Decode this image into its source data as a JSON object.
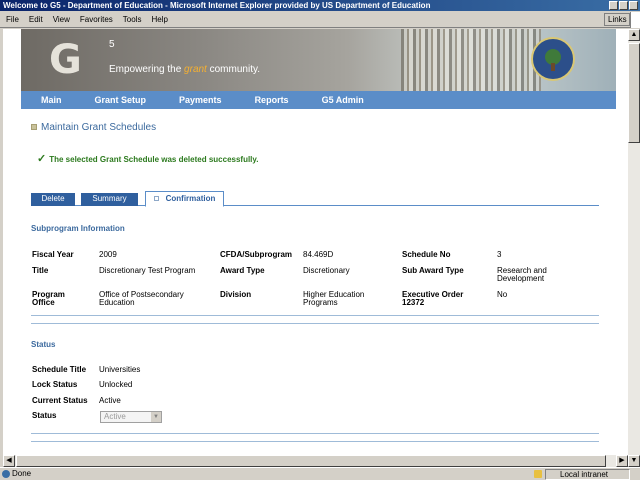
{
  "window": {
    "title": "Welcome to G5 - Department of Education - Microsoft Internet Explorer provided by US Department of Education"
  },
  "menu": [
    "File",
    "Edit",
    "View",
    "Favorites",
    "Tools",
    "Help"
  ],
  "links_label": "Links",
  "banner": {
    "logo": "G",
    "logo_sup": "5",
    "tagline_pre": "Empowering the ",
    "tagline_hl": "grant",
    "tagline_post": " community."
  },
  "nav": [
    "Main",
    "Grant Setup",
    "Payments",
    "Reports",
    "G5 Admin"
  ],
  "page": {
    "title": "Maintain Grant Schedules",
    "success": "The selected Grant Schedule was deleted successfully."
  },
  "tabs": {
    "delete": "Delete",
    "summary": "Summary",
    "confirmation": "Confirmation"
  },
  "subprogram": {
    "heading": "Subprogram Information",
    "fiscal_year_label": "Fiscal Year",
    "fiscal_year": "2009",
    "cfda_label": "CFDA/Subprogram",
    "cfda": "84.469D",
    "schedule_no_label": "Schedule No",
    "schedule_no": "3",
    "title_label": "Title",
    "title": "Discretionary Test Program",
    "award_type_label": "Award Type",
    "award_type": "Discretionary",
    "sub_award_type_label": "Sub Award Type",
    "sub_award_type_1": "Research and",
    "sub_award_type_2": "Development",
    "program_office_label_1": "Program",
    "program_office_label_2": "Office",
    "program_office_1": "Office of Postsecondary",
    "program_office_2": "Education",
    "division_label": "Division",
    "division_1": "Higher Education",
    "division_2": "Programs",
    "exec_order_label_1": "Executive Order",
    "exec_order_label_2": "12372",
    "exec_order": "No"
  },
  "status": {
    "heading": "Status",
    "schedule_title_label": "Schedule Title",
    "schedule_title": "Universities",
    "lock_status_label": "Lock Status",
    "lock_status": "Unlocked",
    "current_status_label": "Current Status",
    "current_status": "Active",
    "status_label": "Status",
    "status_value": "Active"
  },
  "statusbar": {
    "left": "Done",
    "zone": "Local intranet"
  }
}
